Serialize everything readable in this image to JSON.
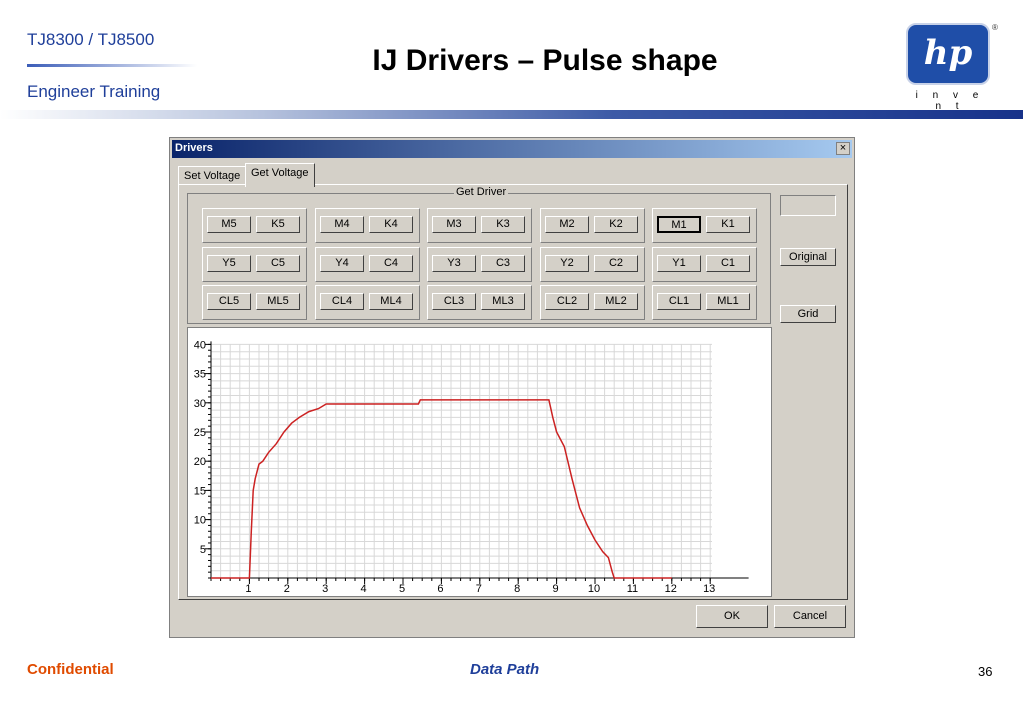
{
  "slide": {
    "product": "TJ8300 / TJ8500",
    "subtitle": "Engineer  Training",
    "title": "IJ Drivers – Pulse shape",
    "logo_text": "hp",
    "logo_mark": "®",
    "tagline": "i n v e n t",
    "footer_left": "Confidential",
    "footer_center": "Data Path",
    "page_number": "36"
  },
  "colors": {
    "accent": "#1f3f9a",
    "footer_warning": "#e04b00",
    "plot_line": "#cc2222",
    "logo_bg": "#1f4ea8"
  },
  "window": {
    "title": "Drivers",
    "close_label": "×",
    "tabs": [
      {
        "label": "Set Voltage"
      },
      {
        "label": "Get Voltage"
      }
    ],
    "active_tab": 1,
    "group_label": "Get Driver",
    "driver_groups": [
      [
        [
          "M5",
          "K5"
        ],
        [
          "Y5",
          "C5"
        ],
        [
          "CL5",
          "ML5"
        ]
      ],
      [
        [
          "M4",
          "K4"
        ],
        [
          "Y4",
          "C4"
        ],
        [
          "CL4",
          "ML4"
        ]
      ],
      [
        [
          "M3",
          "K3"
        ],
        [
          "Y3",
          "C3"
        ],
        [
          "CL3",
          "ML3"
        ]
      ],
      [
        [
          "M2",
          "K2"
        ],
        [
          "Y2",
          "C2"
        ],
        [
          "CL2",
          "ML2"
        ]
      ],
      [
        [
          "M1",
          "K1"
        ],
        [
          "Y1",
          "C1"
        ],
        [
          "CL1",
          "ML1"
        ]
      ]
    ],
    "selected_driver": "M1",
    "side_value": "",
    "original_button": "Original",
    "grid_button": "Grid",
    "ok_button": "OK",
    "cancel_button": "Cancel"
  },
  "chart_data": {
    "type": "line",
    "title": "",
    "xlabel": "",
    "ylabel": "",
    "xlim": [
      0,
      14
    ],
    "ylim": [
      0,
      40
    ],
    "grid": true,
    "x_ticks": [
      "1",
      "2",
      "3",
      "4",
      "5",
      "6",
      "7",
      "8",
      "9",
      "10",
      "11",
      "12",
      "13"
    ],
    "y_ticks": [
      "5",
      "10",
      "15",
      "20",
      "25",
      "30",
      "35",
      "40"
    ],
    "series": [
      {
        "x": [
          0,
          1.0,
          1.05,
          1.1,
          1.15,
          1.25,
          1.35,
          1.5,
          1.7,
          1.9,
          2.1,
          2.3,
          2.55,
          2.8,
          3.0,
          5.4,
          5.45,
          8.8,
          8.9,
          9.0,
          9.2,
          9.4,
          9.6,
          9.8,
          10.0,
          10.2,
          10.35,
          10.45,
          10.5,
          12.0
        ],
        "y": [
          0,
          0,
          8,
          15,
          17,
          19.5,
          20,
          21.5,
          23,
          25,
          26.5,
          27.5,
          28.5,
          29,
          29.8,
          29.8,
          30.5,
          30.5,
          27.5,
          25,
          22.5,
          17,
          12,
          9,
          6.5,
          4.5,
          3.5,
          1,
          0,
          0
        ]
      }
    ]
  }
}
